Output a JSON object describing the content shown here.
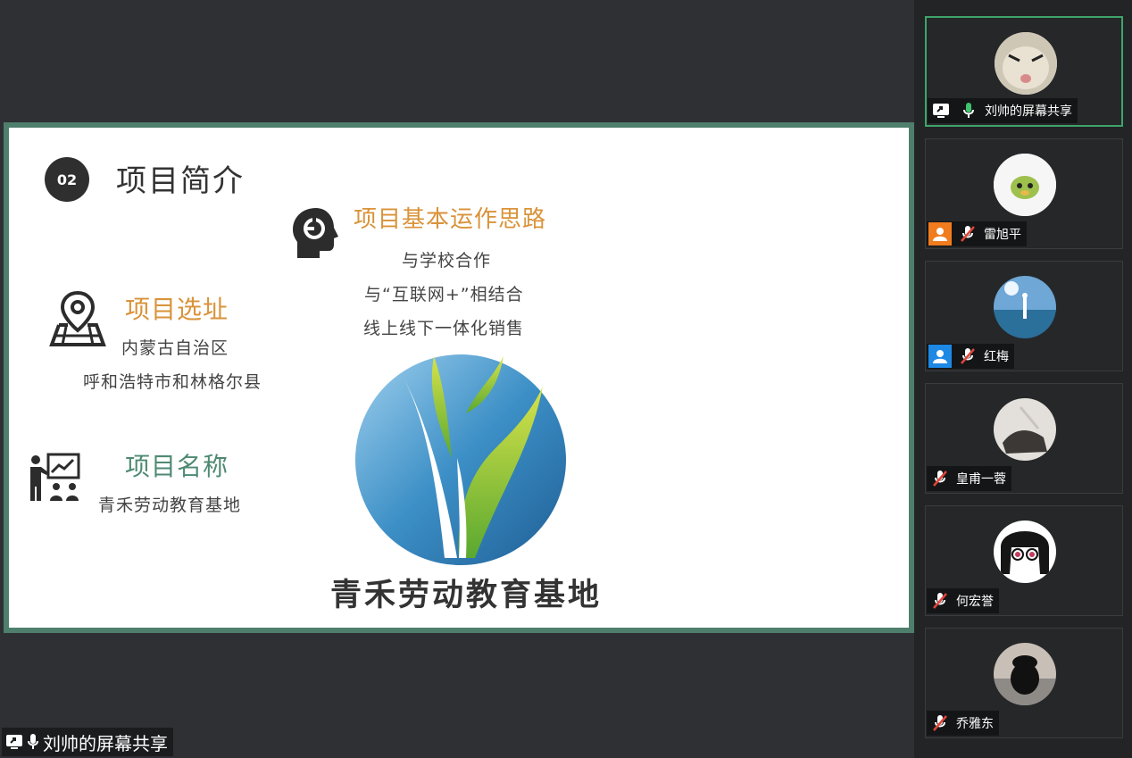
{
  "slide": {
    "badge": "02",
    "title": "项目简介",
    "approach": {
      "title": "项目基本运作思路",
      "lines": [
        "与学校合作",
        "与“互联网+”相结合",
        "线上线下一体化销售"
      ]
    },
    "location": {
      "title": "项目选址",
      "lines": [
        "内蒙古自治区",
        "呼和浩特市和林格尔县"
      ]
    },
    "name": {
      "title": "项目名称",
      "lines": [
        "青禾劳动教育基地"
      ]
    },
    "logo_text": "青禾劳动教育基地"
  },
  "share_label": "刘帅的屏幕共享",
  "participants": [
    {
      "name": "刘帅的屏幕共享",
      "mic": "on",
      "sharing": true,
      "active": true
    },
    {
      "name": "雷旭平",
      "mic": "muted",
      "role_badge": "orange"
    },
    {
      "name": "红梅",
      "mic": "muted",
      "role_badge": "blue"
    },
    {
      "name": "皇甫一蓉",
      "mic": "muted"
    },
    {
      "name": "何宏誉",
      "mic": "muted"
    },
    {
      "name": "乔雅东",
      "mic": "muted"
    }
  ],
  "colors": {
    "accent_orange": "#d9933a",
    "accent_green": "#4e8a73",
    "active_border": "#3ea46a",
    "slide_frame": "#4e7f6c"
  }
}
